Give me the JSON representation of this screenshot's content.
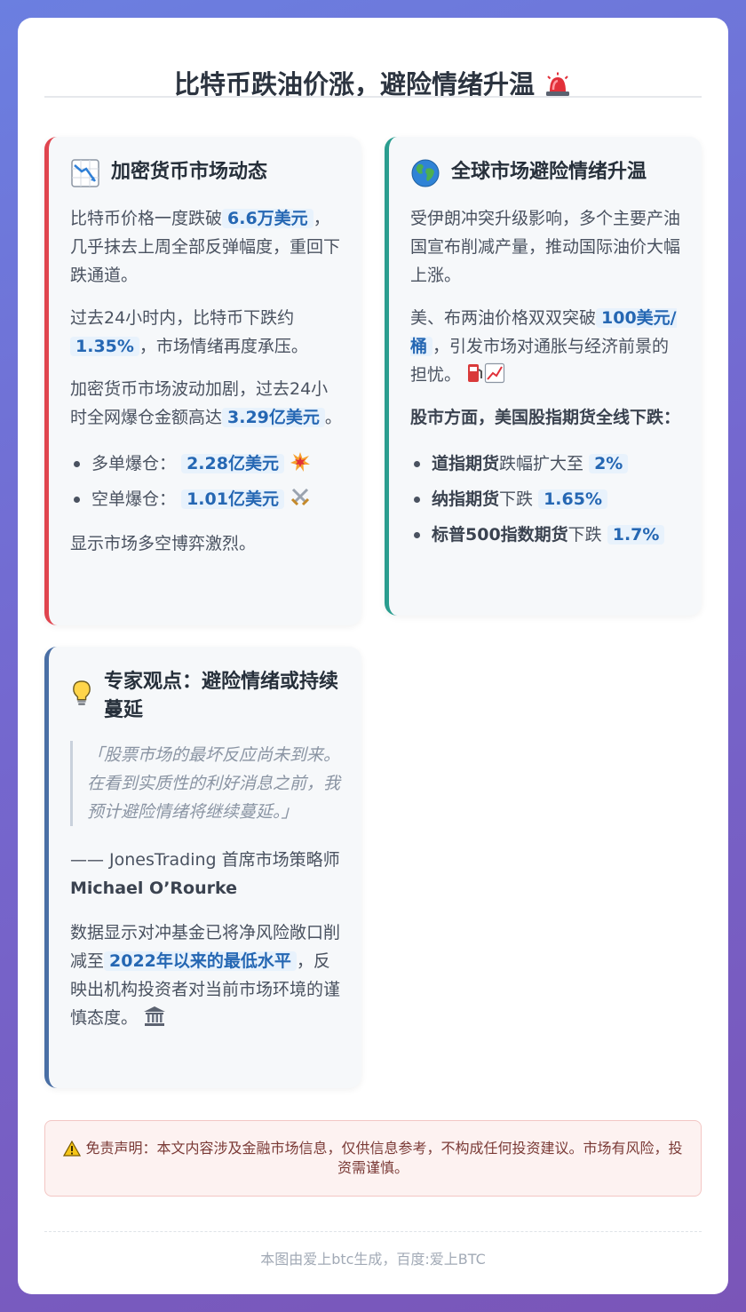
{
  "title": "比特币跌油价涨，避险情绪升温",
  "crypto": {
    "heading": "加密货币市场动态",
    "p1_a": "比特币价格一度跌破",
    "p1_hl": "6.6万美元",
    "p1_b": "，几乎抹去上周全部反弹幅度，重回下跌通道。",
    "p2_a": "过去24小时内，比特币下跌约",
    "p2_hl": "1.35%",
    "p2_b": "，市场情绪再度承压。",
    "p3_a": "加密货币市场波动加剧，过去24小时全网爆仓金额高达",
    "p3_hl": "3.29亿美元",
    "p3_b": "。",
    "long_label": "多单爆仓：",
    "long_value": "2.28亿美元",
    "short_label": "空单爆仓：",
    "short_value": "1.01亿美元",
    "p4": "显示市场多空博弈激烈。"
  },
  "global": {
    "heading": "全球市场避险情绪升温",
    "p1": "受伊朗冲突升级影响，多个主要产油国宣布削减产量，推动国际油价大幅上涨。",
    "p2_a": "美、布两油价格双双突破",
    "p2_hl": "100美元/桶",
    "p2_b": "，引发市场对通胀与经济前景的担忧。",
    "p3": "股市方面，美国股指期货全线下跌：",
    "items": [
      {
        "name": "道指期货",
        "verb": "跌幅扩大至",
        "value": "2%"
      },
      {
        "name": "纳指期货",
        "verb": "下跌",
        "value": "1.65%"
      },
      {
        "name": "标普500指数期货",
        "verb": "下跌",
        "value": "1.7%"
      }
    ]
  },
  "expert": {
    "heading": "专家观点：避险情绪或持续蔓延",
    "quote": "「股票市场的最坏反应尚未到来。在看到实质性的利好消息之前，我预计避险情绪将继续蔓延。」",
    "attrib": "—— JonesTrading 首席市场策略师",
    "attrib_name": "Michael O’Rourke",
    "p_a": "数据显示对冲基金已将净风险敞口削减至",
    "p_hl": "2022年以来的最低水平",
    "p_b": "，反映出机构投资者对当前市场环境的谨慎态度。"
  },
  "disclaimer": "免责声明：本文内容涉及金融市场信息，仅供信息参考，不构成任何投资建议。市场有风险，投资需谨慎。",
  "footer": "本图由爱上btc生成，百度:爱上BTC"
}
